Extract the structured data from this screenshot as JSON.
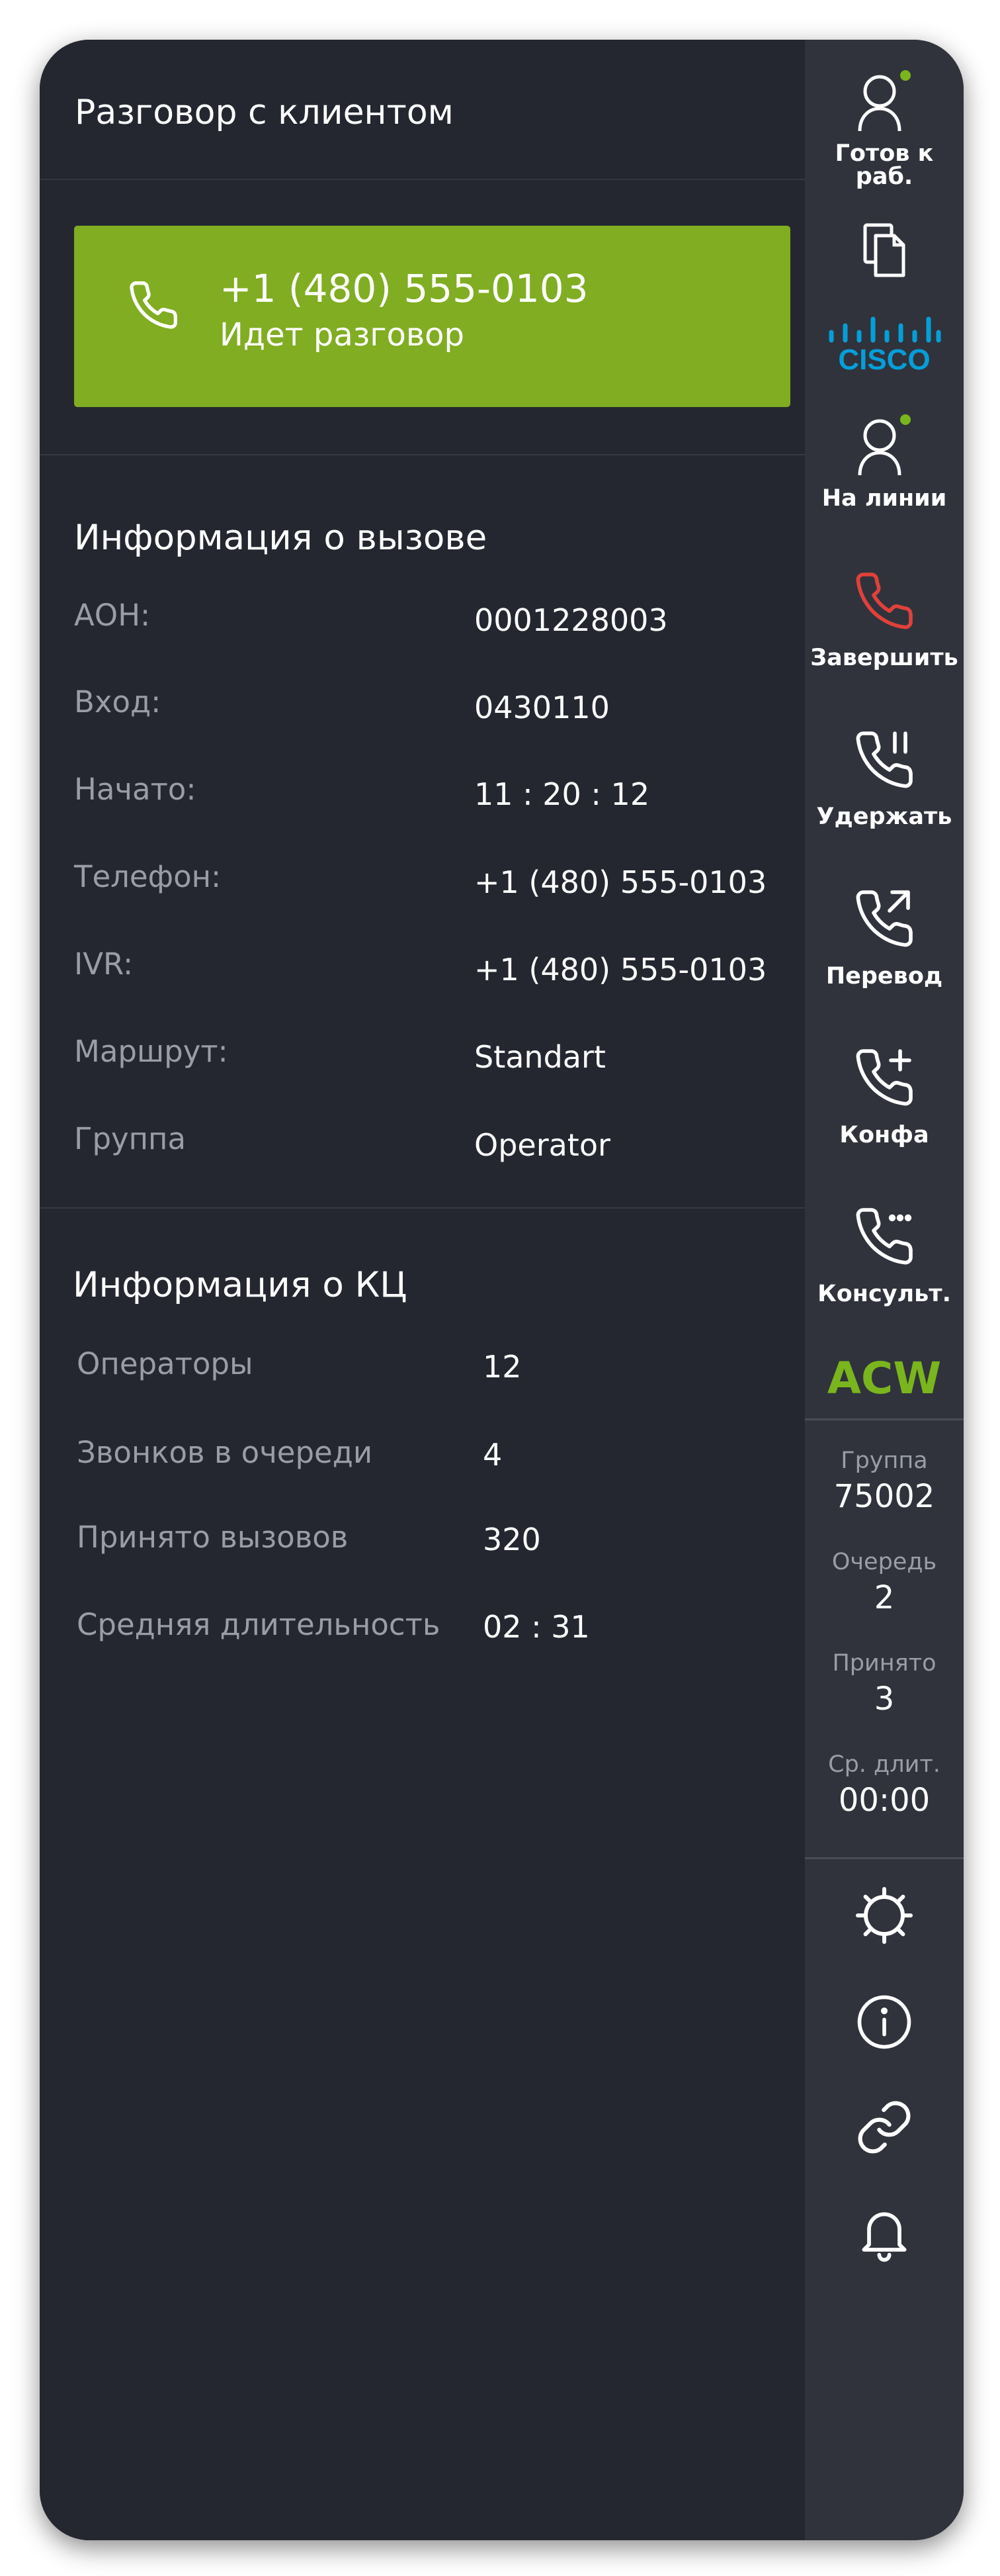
{
  "header": {
    "title": "Разговор с клиентом"
  },
  "call": {
    "number": "+1 (480) 555-0103",
    "status": "Идет разговор"
  },
  "call_info": {
    "title": "Информация о вызове",
    "rows": [
      {
        "label": "АОН:",
        "value": "0001228003"
      },
      {
        "label": "Вход:",
        "value": "0430110"
      },
      {
        "label": "Начато:",
        "value": "11 : 20 : 12"
      },
      {
        "label": "Телефон:",
        "value": "+1 (480) 555-0103"
      },
      {
        "label": "IVR:",
        "value": "+1 (480) 555-0103"
      },
      {
        "label": "Маршрут:",
        "value": "Standart"
      },
      {
        "label": "Группа",
        "value": "Operator"
      }
    ]
  },
  "cc_info": {
    "title": "Информация о КЦ",
    "rows": [
      {
        "label": "Операторы",
        "value": "12"
      },
      {
        "label": "Звонков в очереди",
        "value": "4"
      },
      {
        "label": "Принято вызовов",
        "value": "320"
      },
      {
        "label": "Средняя длительность",
        "value": "02 : 31"
      }
    ]
  },
  "sidebar": {
    "ready": {
      "label": "Готов к раб.",
      "icon": "user-icon"
    },
    "docs": {
      "icon": "documents-icon"
    },
    "cisco": {
      "logo_text": "CISCO",
      "color": "#049fd9"
    },
    "online": {
      "label": "На линии",
      "icon": "user-icon"
    },
    "end": {
      "label": "Завершить",
      "icon": "phone-hangup-icon",
      "color": "#e0413a"
    },
    "hold": {
      "label": "Удержать",
      "icon": "phone-pause-icon"
    },
    "transfer": {
      "label": "Перевод",
      "icon": "phone-forward-icon"
    },
    "conf": {
      "label": "Конфа",
      "icon": "phone-plus-icon"
    },
    "consult": {
      "label": "Консульт.",
      "icon": "phone-more-icon"
    },
    "acw": "ACW",
    "stats": [
      {
        "label": "Группа",
        "value": "75002"
      },
      {
        "label": "Очередь",
        "value": "2"
      },
      {
        "label": "Принято",
        "value": "3"
      },
      {
        "label": "Ср. длит.",
        "value": "00:00"
      }
    ],
    "bottom_icons": [
      "gear-icon",
      "info-icon",
      "link-icon",
      "bell-icon"
    ]
  },
  "colors": {
    "accent_green": "#80ad22",
    "status_dot": "#7ab51d",
    "panel_bg": "#252730",
    "sidebar_bg": "#30333c"
  }
}
